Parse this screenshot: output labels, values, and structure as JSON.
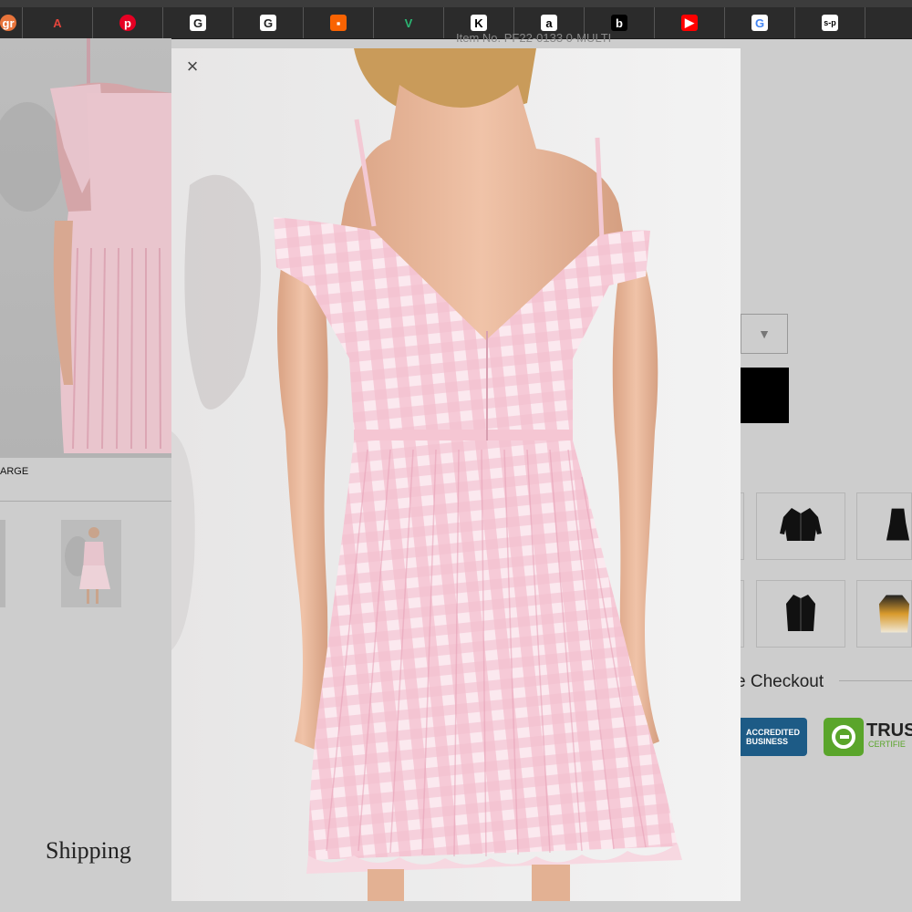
{
  "bookmarks": [
    {
      "icon": "gr-icon",
      "glyph": "gr",
      "bg": "#e8743b",
      "fg": "#fff"
    },
    {
      "icon": "anthropologie-icon",
      "glyph": "A",
      "bg": "transparent",
      "fg": "#e2453c"
    },
    {
      "icon": "pinterest-icon",
      "glyph": "p",
      "bg": "#e60023",
      "fg": "#fff"
    },
    {
      "icon": "g-icon",
      "glyph": "G",
      "bg": "#fff",
      "fg": "#222"
    },
    {
      "icon": "g-icon",
      "glyph": "G",
      "bg": "#fff",
      "fg": "#222"
    },
    {
      "icon": "home-depot-icon",
      "glyph": "▪",
      "bg": "#f96302",
      "fg": "#fff"
    },
    {
      "icon": "v-icon",
      "glyph": "V",
      "bg": "transparent",
      "fg": "#2bb673"
    },
    {
      "icon": "k-icon",
      "glyph": "K",
      "bg": "#fff",
      "fg": "#000"
    },
    {
      "icon": "amazon-icon",
      "glyph": "a",
      "bg": "#fff",
      "fg": "#000"
    },
    {
      "icon": "b-icon",
      "glyph": "b",
      "bg": "#000",
      "fg": "#fff"
    },
    {
      "icon": "youtube-icon",
      "glyph": "▶",
      "bg": "#ff0000",
      "fg": "#fff"
    },
    {
      "icon": "google-icon",
      "glyph": "G",
      "bg": "#fff",
      "fg": "#4285f4"
    },
    {
      "icon": "sp-icon",
      "glyph": "s-p",
      "bg": "#fff",
      "fg": "#000"
    }
  ],
  "product": {
    "item_no": "Item No. PF22-0133 0-MULTI",
    "size_label": "ARGE",
    "select_arrow": "▼"
  },
  "footer": {
    "shipping": "Shipping",
    "checkout": "e Checkout",
    "bbb_line1": "ACCREDITED",
    "bbb_line2": "BUSINESS",
    "trust_name": "TRUS",
    "trust_sub": "CERTIFIE"
  },
  "modal": {
    "close_glyph": "×"
  },
  "colors": {
    "dress_pink": "#f2b8c8",
    "dress_white": "#fbeef2",
    "skin": "#e8b79c",
    "backdrop": "#efefef"
  }
}
